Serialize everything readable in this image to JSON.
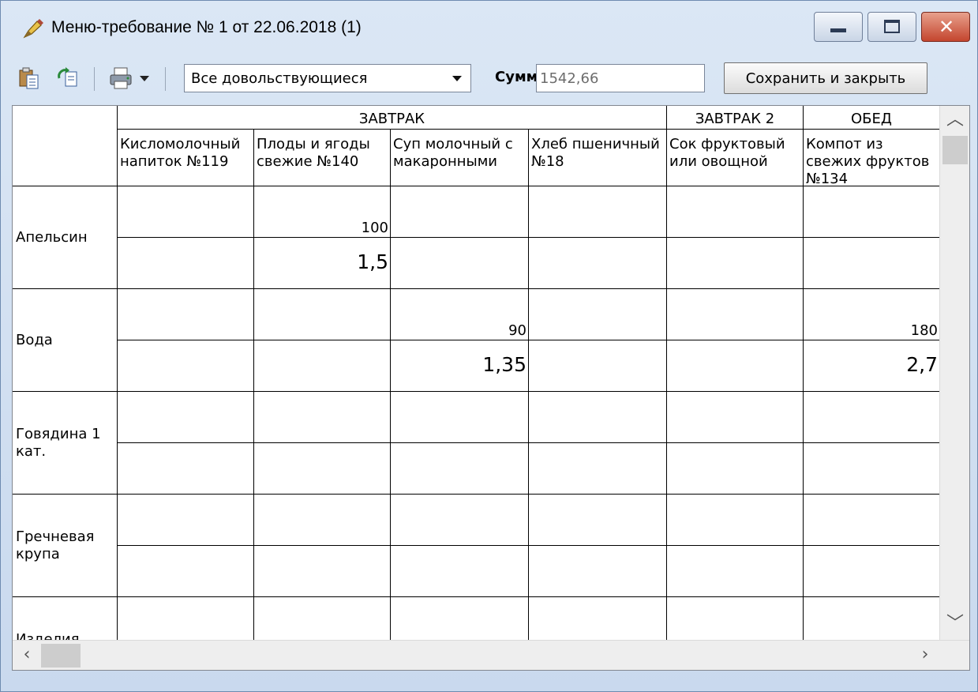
{
  "window": {
    "title": "Меню-требование № 1 от 22.06.2018 (1)",
    "close_glyph": "✕",
    "accent": "#c4452e"
  },
  "toolbar": {
    "icons": [
      "paste-icon",
      "refresh-icon",
      "print-icon",
      "dropdown-arrow-icon"
    ],
    "filter_value": "Все довольствующиеся",
    "sum_label": "Сумма:",
    "sum_value": "1542,66",
    "save_label": "Сохранить и закрыть"
  },
  "grid": {
    "meal_groups": [
      {
        "label": "ЗАВТРАК"
      },
      {
        "label": "ЗАВТРАК 2"
      },
      {
        "label": "ОБЕД"
      }
    ],
    "dishes": [
      {
        "label": "Кисломолочный напиток №119"
      },
      {
        "label": "Плоды и ягоды свежие №140"
      },
      {
        "label": "Суп молочный с макаронными"
      },
      {
        "label": "Хлеб пшеничный №18"
      },
      {
        "label": "Сок фруктовый или овощной"
      },
      {
        "label": "Компот из свежих фруктов №134"
      }
    ],
    "rows": [
      {
        "label": "Апельсин",
        "qty": [
          "",
          "100",
          "",
          "",
          "",
          ""
        ],
        "cost": [
          "",
          "1,5",
          "",
          "",
          "",
          ""
        ]
      },
      {
        "label": "Вода",
        "qty": [
          "",
          "",
          "90",
          "",
          "",
          "180"
        ],
        "cost": [
          "",
          "",
          "1,35",
          "",
          "",
          "2,7"
        ]
      },
      {
        "label": "Говядина 1 кат.",
        "qty": [
          "",
          "",
          "",
          "",
          "",
          ""
        ],
        "cost": [
          "",
          "",
          "",
          "",
          "",
          ""
        ]
      },
      {
        "label": "Гречневая крупа",
        "qty": [
          "",
          "",
          "",
          "",
          "",
          ""
        ],
        "cost": [
          "",
          "",
          "",
          "",
          "",
          ""
        ]
      },
      {
        "label": "Изделия формованные",
        "qty": [
          "",
          "",
          "",
          "",
          "",
          ""
        ],
        "cost": [
          "",
          "",
          "",
          "",
          "",
          ""
        ]
      }
    ]
  }
}
